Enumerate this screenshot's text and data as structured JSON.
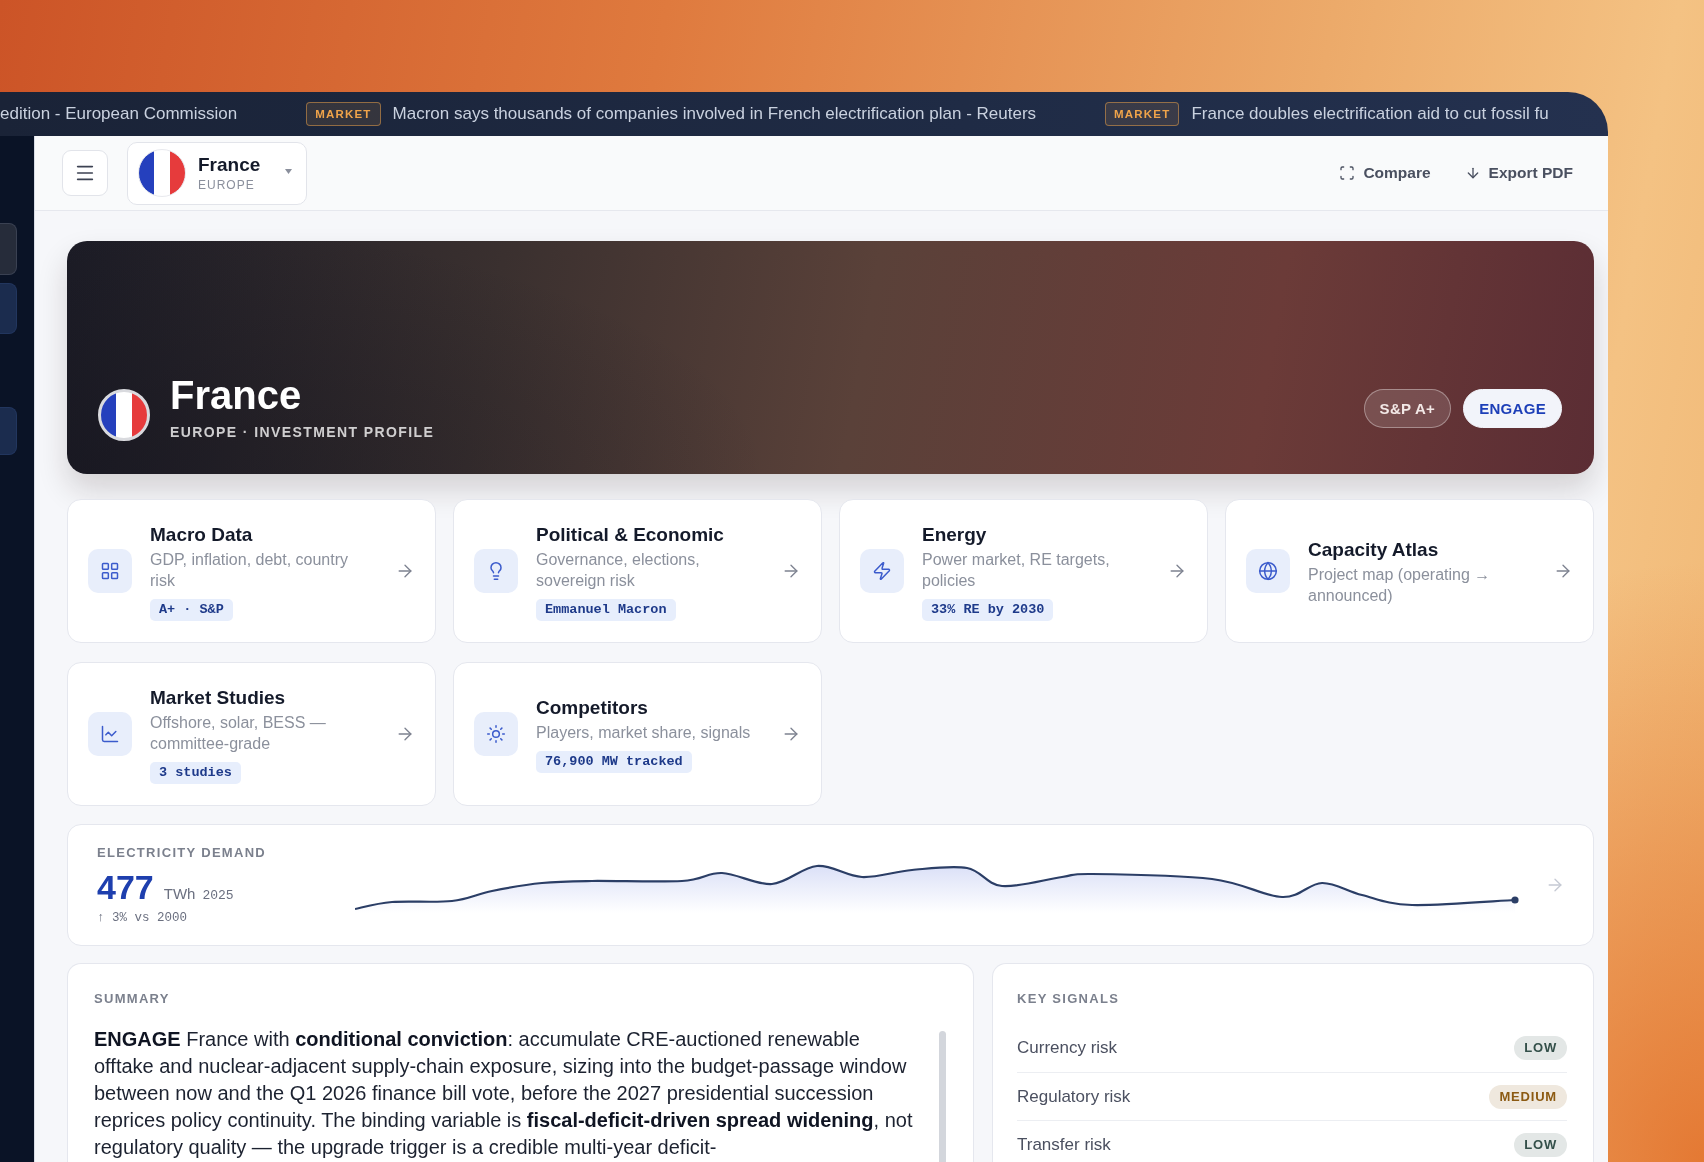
{
  "ticker": [
    {
      "text": "edition - European Commission"
    },
    {
      "badge": "MARKET",
      "text": "Macron says thousands of companies involved in French electrification plan - Reuters"
    },
    {
      "badge": "MARKET",
      "text": "France doubles electrification aid to cut fossil fu"
    }
  ],
  "header": {
    "country": {
      "name": "France",
      "region": "EUROPE"
    },
    "actions": [
      "Compare",
      "Export PDF"
    ]
  },
  "hero": {
    "title": "France",
    "subtitle": "EUROPE · INVESTMENT PROFILE",
    "badges": [
      {
        "label": "S&P A+",
        "kind": "outline"
      },
      {
        "label": "ENGAGE",
        "kind": "solid"
      }
    ]
  },
  "modules": [
    {
      "title": "Macro Data",
      "description": "GDP, inflation, debt, country risk",
      "tag": "A+ · S&P"
    },
    {
      "title": "Political & Economic",
      "description": "Governance, elections, sovereign risk",
      "tag": "Emmanuel Macron"
    },
    {
      "title": "Energy",
      "description": "Power market, RE targets, policies",
      "tag": "33% RE by 2030"
    },
    {
      "title": "Capacity Atlas",
      "description": "Project map (operating → announced)"
    },
    {
      "title": "Market Studies",
      "description": "Offshore, solar, BESS — committee-grade",
      "tag": "3 studies"
    },
    {
      "title": "Competitors",
      "description": "Players, market share, signals",
      "tag": "76,900 MW tracked"
    }
  ],
  "electricity_demand": {
    "label": "ELECTRICITY DEMAND",
    "value": "477",
    "unit": "TWh",
    "year": "2025",
    "change": "↑ 3% vs 2000"
  },
  "summary": {
    "label": "SUMMARY",
    "text": "**ENGAGE** France with **conditional conviction**: accumulate CRE-auctioned renewable offtake and nuclear-adjacent supply-chain exposure, sizing into the budget-passage window between now and the Q1 2026 finance bill vote, before the 2027 presidential succession reprices policy continuity. The binding variable is **fiscal-deficit-driven spread widening**, not regulatory quality — the upgrade trigger is a credible multi-year deficit-"
  },
  "key_signals": {
    "label": "KEY SIGNALS",
    "items": [
      {
        "name": "Currency risk",
        "rating": "LOW",
        "color": "#34504a"
      },
      {
        "name": "Regulatory risk",
        "rating": "MEDIUM",
        "color": "#8c5a12"
      },
      {
        "name": "Transfer risk",
        "rating": "LOW",
        "color": "#34504a"
      }
    ]
  }
}
